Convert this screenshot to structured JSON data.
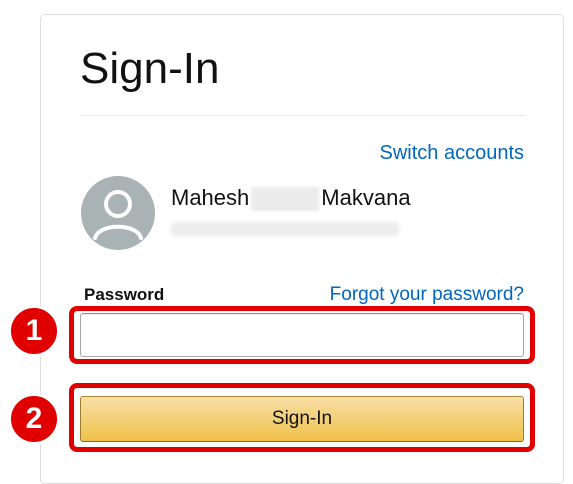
{
  "page": {
    "title": "Sign-In"
  },
  "account": {
    "switch_label": "Switch accounts",
    "first_name": "Mahesh",
    "last_name": "Makvana"
  },
  "password": {
    "label": "Password",
    "forgot_label": "Forgot your password?",
    "value": "",
    "placeholder": ""
  },
  "submit": {
    "label": "Sign-In"
  },
  "annotations": {
    "step1": "1",
    "step2": "2"
  },
  "colors": {
    "link": "#0066c0",
    "button_top": "#f7dfa5",
    "button_bottom": "#f0c14b",
    "highlight": "#e00000",
    "avatar": "#a9b3b3"
  }
}
